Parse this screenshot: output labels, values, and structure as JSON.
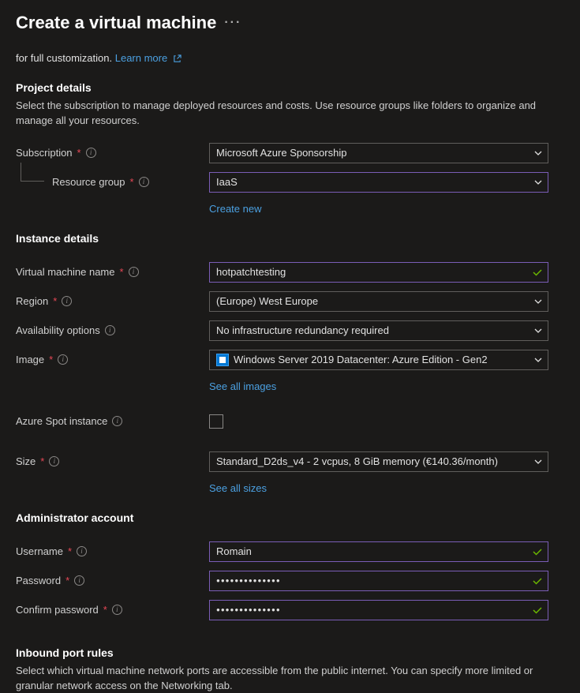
{
  "page": {
    "title": "Create a virtual machine",
    "intro_prefix": "for full customization.",
    "learn_more": "Learn more"
  },
  "project": {
    "title": "Project details",
    "desc": "Select the subscription to manage deployed resources and costs. Use resource groups like folders to organize and manage all your resources.",
    "subscription_label": "Subscription",
    "subscription_value": "Microsoft Azure Sponsorship",
    "rg_label": "Resource group",
    "rg_value": "IaaS",
    "create_new": "Create new"
  },
  "instance": {
    "title": "Instance details",
    "vmname_label": "Virtual machine name",
    "vmname_value": "hotpatchtesting",
    "region_label": "Region",
    "region_value": "(Europe) West Europe",
    "avail_label": "Availability options",
    "avail_value": "No infrastructure redundancy required",
    "image_label": "Image",
    "image_value": "Windows Server 2019 Datacenter: Azure Edition - Gen2",
    "see_images": "See all images",
    "spot_label": "Azure Spot instance",
    "size_label": "Size",
    "size_value": "Standard_D2ds_v4 - 2 vcpus, 8 GiB memory (€140.36/month)",
    "see_sizes": "See all sizes"
  },
  "admin": {
    "title": "Administrator account",
    "username_label": "Username",
    "username_value": "Romain",
    "password_label": "Password",
    "password_value": "●●●●●●●●●●●●●●",
    "confirm_label": "Confirm password",
    "confirm_value": "●●●●●●●●●●●●●●"
  },
  "ports": {
    "title": "Inbound port rules",
    "desc": "Select which virtual machine network ports are accessible from the public internet. You can specify more limited or granular network access on the Networking tab."
  }
}
